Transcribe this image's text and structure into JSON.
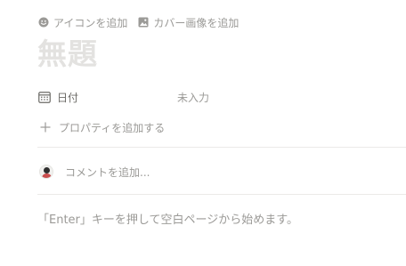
{
  "page_controls": {
    "add_icon_label": "アイコンを追加",
    "add_cover_label": "カバー画像を追加"
  },
  "title": "無題",
  "properties": [
    {
      "icon": "calendar-icon",
      "name": "日付",
      "value": "未入力"
    }
  ],
  "add_property_label": "プロパティを追加する",
  "comment": {
    "placeholder": "コメントを追加..."
  },
  "empty_hint": "「Enter」キーを押して空白ページから始めます。",
  "colors": {
    "text": "#37352f",
    "muted": "#9b9a97",
    "title_placeholder": "#e3e2e0",
    "divider": "#ebeae8"
  }
}
